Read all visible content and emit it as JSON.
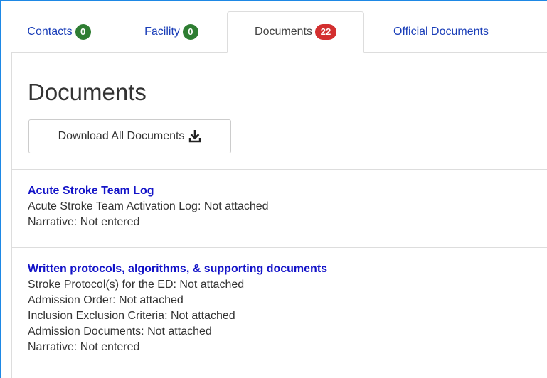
{
  "tabs": [
    {
      "label": "Contacts",
      "badge": "0",
      "badge_color": "#2e7d32"
    },
    {
      "label": "Facility",
      "badge": "0",
      "badge_color": "#2e7d32"
    },
    {
      "label": "Documents",
      "badge": "22",
      "badge_color": "#d32f2f",
      "active": true
    },
    {
      "label": "Official Documents"
    }
  ],
  "page": {
    "title": "Documents",
    "download_label": "Download All Documents"
  },
  "groups": [
    {
      "title": "Acute Stroke Team Log",
      "lines": [
        "Acute Stroke Team Activation Log: Not attached",
        "Narrative: Not entered"
      ]
    },
    {
      "title": "Written protocols, algorithms, & supporting documents",
      "lines": [
        "Stroke Protocol(s) for the ED: Not attached",
        "Admission Order: Not attached",
        "Inclusion Exclusion Criteria: Not attached",
        "Admission Documents: Not attached",
        "Narrative: Not entered"
      ]
    }
  ],
  "colors": {
    "link": "#1414c8",
    "tab_link": "#1a3eb8",
    "frame_accent": "#1e88e5"
  },
  "icons": {
    "download": "download-icon"
  }
}
